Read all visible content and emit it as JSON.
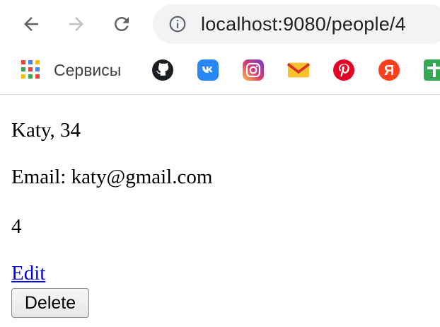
{
  "browser": {
    "url": "localhost:9080/people/4",
    "bookmarks": {
      "services_label": "Сервисы",
      "items": [
        "github-icon",
        "vk-icon",
        "instagram-icon",
        "gmail-icon",
        "pinterest-icon",
        "yandex-icon",
        "plus-icon"
      ]
    },
    "colors": {
      "toolbar_bg": "#ffffff",
      "omnibox_bg": "#f1f3f4",
      "nav_icon": "#5f6368",
      "nav_icon_disabled": "#bdc1c6"
    }
  },
  "person": {
    "name_age": "Katy, 34",
    "email_line": "Email: katy@gmail.com",
    "id": "4"
  },
  "actions": {
    "edit_label": "Edit",
    "delete_label": "Delete"
  }
}
